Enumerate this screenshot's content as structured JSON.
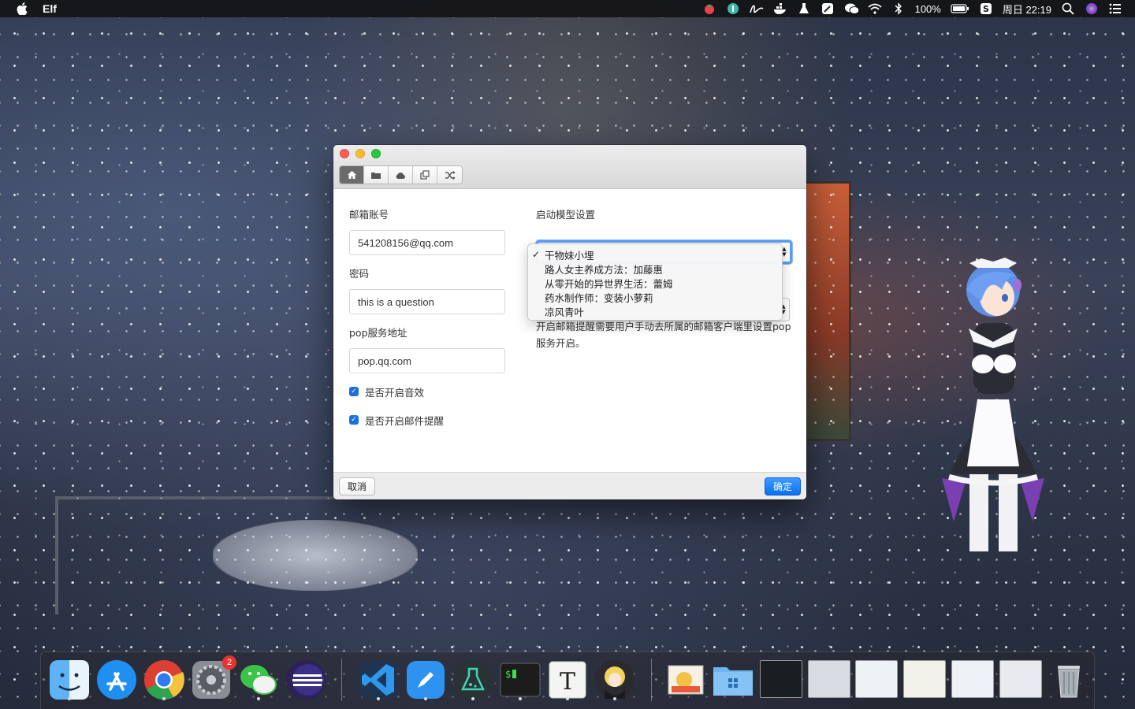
{
  "menubar": {
    "app_name": "Elf",
    "battery": "100%",
    "datetime": "周日 22:19",
    "icons": [
      "tomato-icon",
      "pin-icon",
      "signature-icon",
      "docker-icon",
      "flask-icon",
      "pen-app-icon",
      "wechat-icon",
      "wifi-icon",
      "bluetooth-icon",
      "battery-icon",
      "sogou-icon",
      "spotlight-icon",
      "siri-icon",
      "notification-center-icon"
    ]
  },
  "window": {
    "toolbar_icons": [
      "home-icon",
      "folder-icon",
      "cloud-icon",
      "copy-icon",
      "shuffle-icon"
    ],
    "email_label": "邮箱账号",
    "email_value": "541208156@qq.com",
    "password_label": "密码",
    "password_value": "this is a question",
    "pop_label": "pop服务地址",
    "pop_value": "pop.qq.com",
    "sound_label": "是否开启音效",
    "sound_checked": true,
    "mail_alert_label": "是否开启邮件提醒",
    "mail_alert_checked": true,
    "model_label": "启动模型设置",
    "model_options": [
      "干物妹小埋",
      "路人女主养成方法：加藤惠",
      "从零开始的异世界生活：蕾姆",
      "药水制作师：变装小萝莉",
      "凉风青叶"
    ],
    "model_selected": "干物妹小埋",
    "note": "开启邮箱提醒需要用户手动去所属的邮箱客户端里设置pop服务开启。",
    "cancel_label": "取消",
    "ok_label": "确定"
  },
  "dock": {
    "apps": [
      "finder-icon",
      "app-store-icon",
      "chrome-icon",
      "system-preferences-icon",
      "wechat-icon",
      "eclipse-icon",
      "vscode-icon",
      "pen-app-icon",
      "flask-app-icon",
      "terminal-icon",
      "typora-icon",
      "anime-character-icon"
    ],
    "system_preferences_badge": "2",
    "recent_items": [
      "image-folder",
      "windows-folder",
      "terminal-thumb",
      "window-thumb-1",
      "window-thumb-2",
      "window-thumb-3",
      "window-thumb-4",
      "window-thumb-5",
      "trash-icon"
    ]
  },
  "colors": {
    "accent": "#1d6fde",
    "close": "#fc5f57",
    "minimize": "#fdbc2e",
    "maximize": "#28c840"
  }
}
